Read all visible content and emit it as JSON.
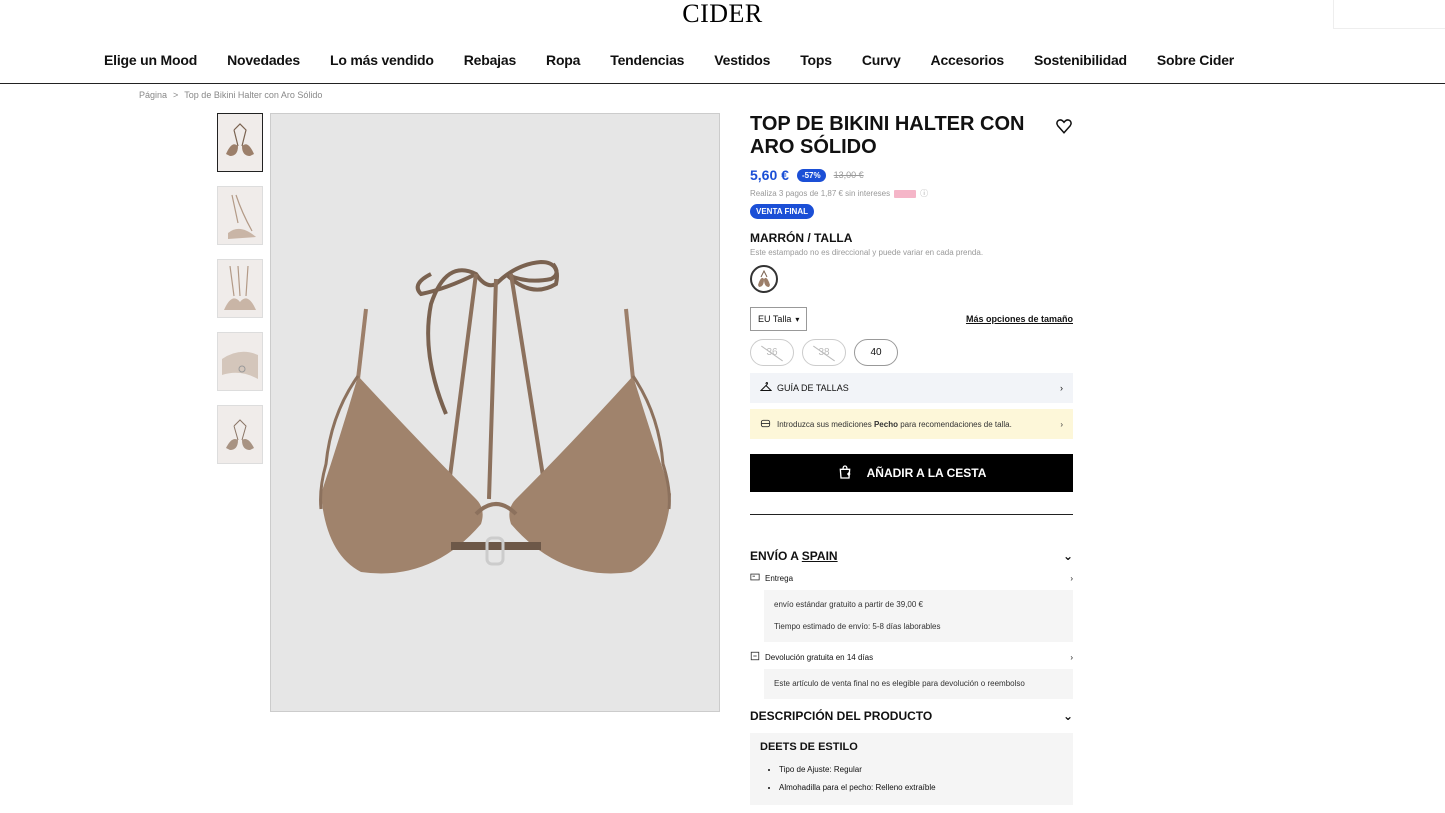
{
  "brand": {
    "logo_text": "CIDER"
  },
  "nav": {
    "items": [
      "Elige un Mood",
      "Novedades",
      "Lo más vendido",
      "Rebajas",
      "Ropa",
      "Tendencias",
      "Vestidos",
      "Tops",
      "Curvy",
      "Accesorios",
      "Sostenibilidad",
      "Sobre Cider"
    ]
  },
  "breadcrumb": {
    "home": "Página",
    "separator": ">",
    "current": "Top de Bikini Halter con Aro Sólido"
  },
  "product": {
    "title": "TOP DE BIKINI HALTER CON ARO SÓLIDO",
    "price": "5,60 €",
    "discount": "-57%",
    "old_price": "13,00 €",
    "installments": "Realiza 3 pagos de 1,87 € sin intereses",
    "final_sale_badge": "VENTA FINAL",
    "variant_label": "MARRÓN / TALLA",
    "variant_note": "Este estampado no es direccional y puede variar en cada prenda.",
    "size_system": "EU Talla",
    "more_sizes_link": "Más opciones de tamaño",
    "sizes": [
      {
        "label": "36",
        "available": false
      },
      {
        "label": "38",
        "available": false
      },
      {
        "label": "40",
        "available": true
      }
    ],
    "size_guide_label": "GUÍA DE TALLAS",
    "measure_prompt_before": "Introduzca sus mediciones",
    "measure_prompt_bold": "Pecho",
    "measure_prompt_after": "para recomendaciones de talla.",
    "add_to_cart": "AÑADIR A LA CESTA"
  },
  "shipping": {
    "heading_prefix": "ENVÍO A",
    "country": "SPAIN",
    "delivery_label": "Entrega",
    "delivery_lines": [
      "envío estándar gratuito a partir de 39,00 €",
      "Tiempo estimado de envío: 5-8 días laborables"
    ],
    "returns_label": "Devolución gratuita en 14 días",
    "returns_note": "Este artículo de venta final no es elegible para devolución o reembolso"
  },
  "description": {
    "heading": "DESCRIPCIÓN DEL PRODUCTO",
    "style_heading": "DEETS DE ESTILO",
    "bullets": [
      "Tipo de Ajuste: Regular",
      "Almohadilla para el pecho: Relleno extraíble"
    ]
  },
  "colors": {
    "accent": "#1b4fd6",
    "product": "#9c7f6a",
    "strap": "#7a6250"
  },
  "icons": [
    "heart-icon",
    "chevron-down-icon",
    "chevron-right-icon",
    "hanger-icon",
    "tape-icon",
    "bag-icon",
    "truck-icon",
    "return-icon",
    "info-icon"
  ]
}
